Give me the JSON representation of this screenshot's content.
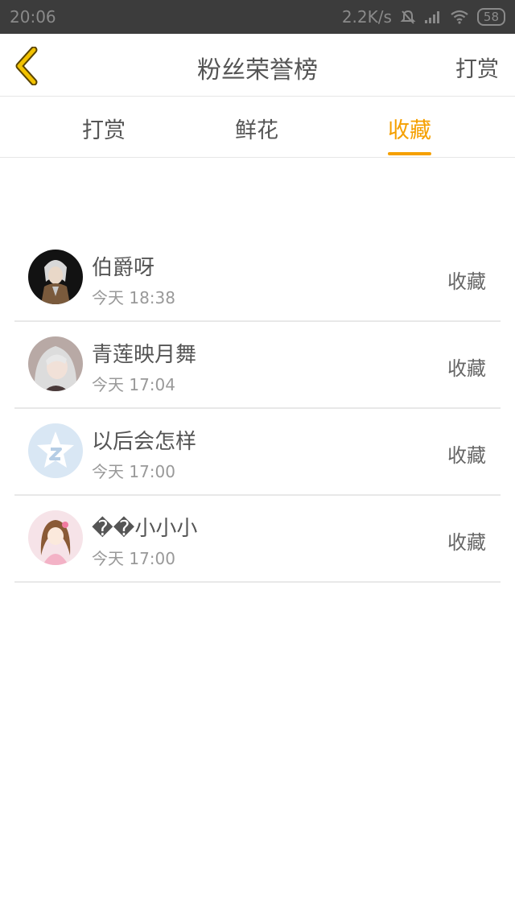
{
  "status_bar": {
    "time": "20:06",
    "net_speed": "2.2K/s",
    "battery": "58"
  },
  "header": {
    "title": "粉丝荣誉榜",
    "action_label": "打赏",
    "back_icon": "chevron-left-icon"
  },
  "tabs": [
    {
      "label": "打赏",
      "active": false
    },
    {
      "label": "鲜花",
      "active": false
    },
    {
      "label": "收藏",
      "active": true
    }
  ],
  "accent_color": "#f5a000",
  "records": [
    {
      "name": "伯爵呀",
      "time": "今天 18:38",
      "action": "收藏"
    },
    {
      "name": "青莲映月舞",
      "time": "今天 17:04",
      "action": "收藏"
    },
    {
      "name": "以后会怎样",
      "time": "今天 17:00",
      "action": "收藏"
    },
    {
      "name": "��小小小",
      "time": "今天 17:00",
      "action": "收藏"
    }
  ]
}
